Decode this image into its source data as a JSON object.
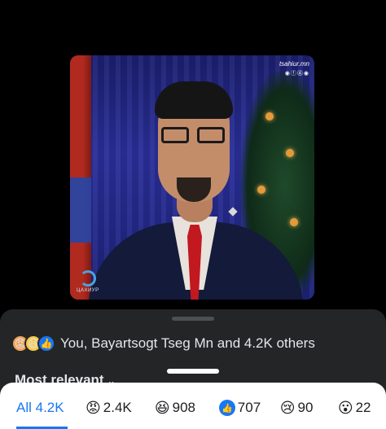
{
  "media": {
    "watermark": "tsahiur.mn",
    "watermark_icons": "◉ⓕ⓸◉",
    "logo_text": "ЦАХИУР"
  },
  "reactions_summary": {
    "icons": [
      "angry-icon",
      "haha-icon",
      "like-icon"
    ],
    "text": "You, Bayartsogt Tseg Mn and 4.2K others"
  },
  "sort": {
    "label": "Most relevant",
    "chevron": "⌄"
  },
  "tabs": [
    {
      "id": "all",
      "label": "All 4.2K",
      "icon": ""
    },
    {
      "id": "angry",
      "label": "2.4K",
      "icon": "😡"
    },
    {
      "id": "haha",
      "label": "908",
      "icon": "😆"
    },
    {
      "id": "like",
      "label": "707",
      "icon": "👍"
    },
    {
      "id": "care",
      "label": "90",
      "icon": "😢"
    },
    {
      "id": "wow",
      "label": "22",
      "icon": "😮"
    }
  ],
  "colors": {
    "accent": "#1877f2",
    "sheet_bg": "#242526",
    "text": "#e4e6eb"
  }
}
